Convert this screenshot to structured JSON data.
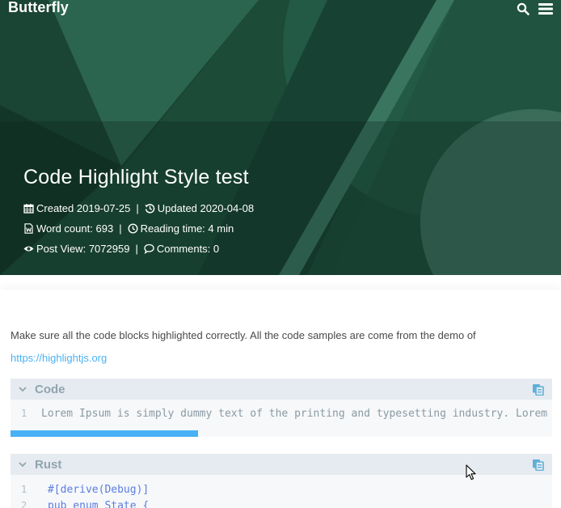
{
  "site": {
    "brand": "Butterfly"
  },
  "nav": {
    "search_icon": "search-icon",
    "menu_icon": "bars-icon"
  },
  "post": {
    "title": "Code Highlight Style test",
    "created_label": "Created",
    "created_date": "2019-07-25",
    "updated_label": "Updated",
    "updated_date": "2020-04-08",
    "word_count_label": "Word count:",
    "word_count": "693",
    "reading_time_label": "Reading time:",
    "reading_time": "4 min",
    "post_view_label": "Post View:",
    "post_view": "7072959",
    "comments_label": "Comments:",
    "comments": "0",
    "separator": "|"
  },
  "content": {
    "intro": "Make sure all the code blocks highlighted correctly. All the code samples are come from the demo of",
    "link": "https://highlightjs.org"
  },
  "code_blocks": [
    {
      "lang": "Code",
      "lines": [
        {
          "num": "1",
          "text": "Lorem Ipsum is simply dummy text of the printing and typesetting industry. Lorem I"
        }
      ]
    },
    {
      "lang": "Rust",
      "lines": [
        {
          "num": "1",
          "text": "#[derive(Debug)]"
        },
        {
          "num": "2",
          "text": "pub enum State {"
        }
      ]
    }
  ],
  "colors": {
    "hero_bg": "#1b4a37",
    "accent": "#49b1f5",
    "code_header": "#e6ebf1",
    "code_bg": "#f6f8fa"
  }
}
